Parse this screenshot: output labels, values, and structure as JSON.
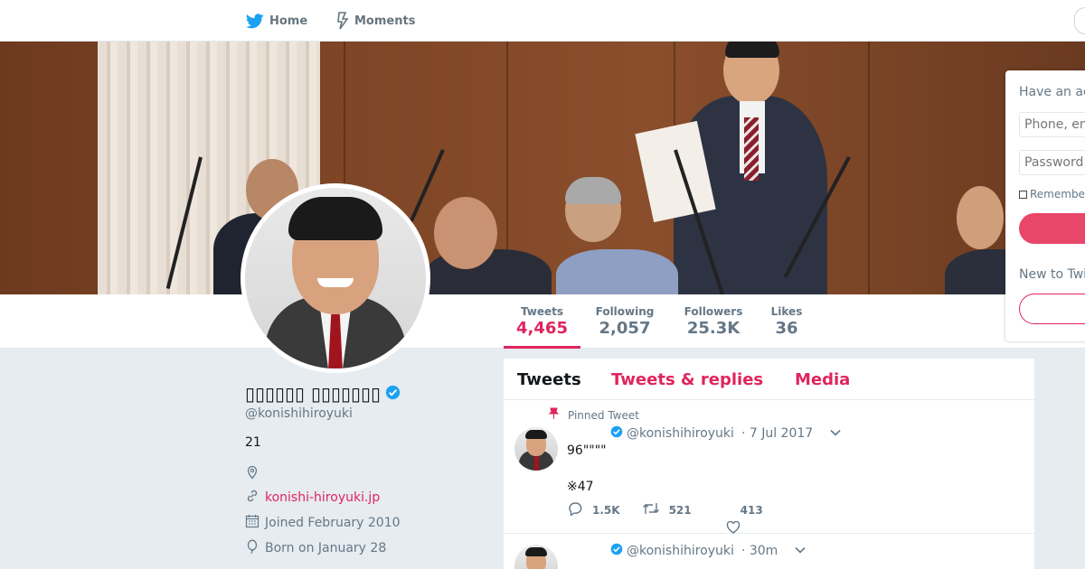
{
  "nav": {
    "home_label": "Home",
    "moments_label": "Moments"
  },
  "profile": {
    "name": "▯▯▯▯▯▯ ▯▯▯▯▯▯▯",
    "handle": "@konishihiroyuki",
    "bio": "21",
    "website": "konishi-hiroyuki.jp",
    "joined": "Joined February 2010",
    "born": "Born on January 28"
  },
  "stats": [
    {
      "label": "Tweets",
      "value": "4,465"
    },
    {
      "label": "Following",
      "value": "2,057"
    },
    {
      "label": "Followers",
      "value": "25.3K"
    },
    {
      "label": "Likes",
      "value": "36"
    }
  ],
  "login": {
    "have_account": "Have an account?",
    "phone_placeholder": "Phone, email or username",
    "password_placeholder": "Password",
    "remember": "Remember me",
    "new_to": "New to Twitter?"
  },
  "timeline": {
    "tabs": [
      "Tweets",
      "Tweets & replies",
      "Media"
    ],
    "tweets": [
      {
        "pinned_label": "Pinned Tweet",
        "handle": "@konishihiroyuki",
        "time": "· 7 Jul 2017",
        "text_line1": "96\"\"\"\"",
        "text_line2": "※47",
        "replies": "1.5K",
        "retweets": "521",
        "likes": "413"
      },
      {
        "handle": "@konishihiroyuki",
        "time": "· 30m"
      }
    ]
  },
  "colors": {
    "accent": "#e0245e",
    "verified": "#1da1f2",
    "text_secondary": "#657786",
    "background": "#e6ecf0"
  },
  "icons": {
    "home": "twitter-bird-icon",
    "moments": "lightning-icon",
    "verified": "verified-badge-icon",
    "location": "location-pin-icon",
    "link": "link-icon",
    "calendar": "calendar-icon",
    "birthday": "balloon-icon",
    "pin": "pin-icon",
    "reply": "reply-icon",
    "retweet": "retweet-icon",
    "like": "heart-icon",
    "caret": "chevron-down-icon"
  }
}
